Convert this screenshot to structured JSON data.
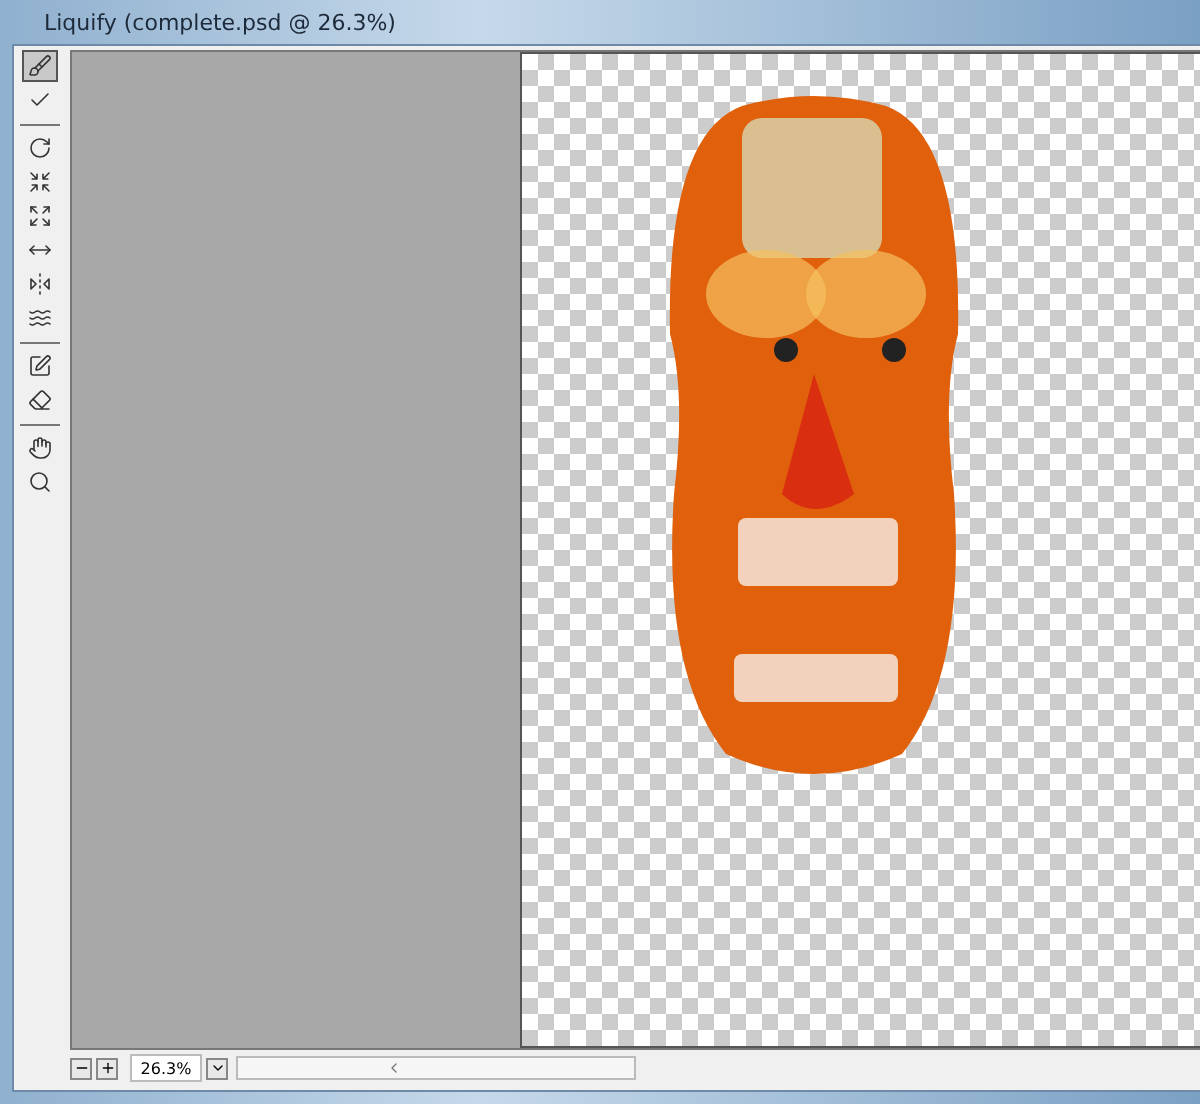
{
  "window": {
    "title": "Liquify (complete.psd @ 26.3%)"
  },
  "tool_groups": [
    {
      "tools": [
        {
          "kind": "warp",
          "selected": true
        },
        {
          "kind": "reconstruct",
          "selected": false
        }
      ]
    },
    {
      "tools": [
        {
          "kind": "twirl",
          "selected": false
        },
        {
          "kind": "pucker",
          "selected": false
        },
        {
          "kind": "bloat",
          "selected": false
        },
        {
          "kind": "push",
          "selected": false
        },
        {
          "kind": "mirror",
          "selected": false
        },
        {
          "kind": "turbulence",
          "selected": false
        }
      ]
    },
    {
      "tools": [
        {
          "kind": "freeze",
          "selected": false
        },
        {
          "kind": "thaw",
          "selected": false
        }
      ]
    },
    {
      "tools": [
        {
          "kind": "hand",
          "selected": false
        },
        {
          "kind": "zoom",
          "selected": false
        }
      ]
    }
  ],
  "zoom_bar": {
    "value": "26.3%"
  }
}
